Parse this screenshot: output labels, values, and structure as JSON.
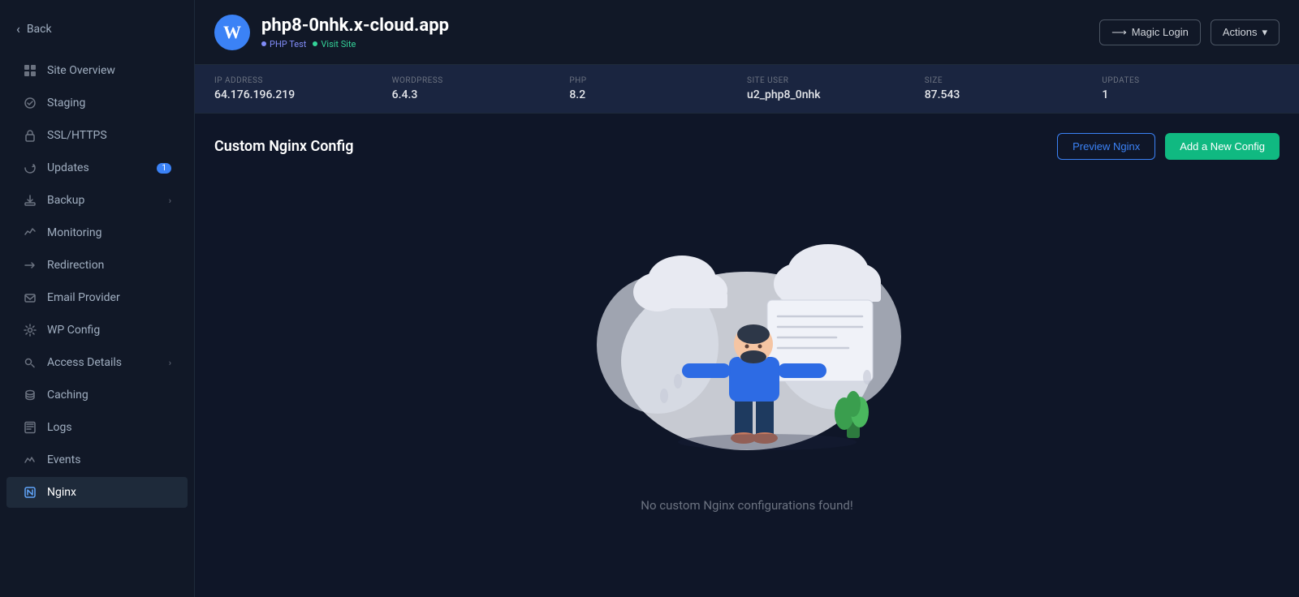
{
  "sidebar": {
    "back_label": "Back",
    "items": [
      {
        "id": "site-overview",
        "label": "Site Overview",
        "icon": "⊞"
      },
      {
        "id": "staging",
        "label": "Staging",
        "icon": "⚡"
      },
      {
        "id": "ssl-https",
        "label": "SSL/HTTPS",
        "icon": "🔒"
      },
      {
        "id": "updates",
        "label": "Updates",
        "icon": "🔄",
        "badge": "1"
      },
      {
        "id": "backup",
        "label": "Backup",
        "icon": "💾",
        "chevron": "›"
      },
      {
        "id": "monitoring",
        "label": "Monitoring",
        "icon": "📊"
      },
      {
        "id": "redirection",
        "label": "Redirection",
        "icon": "↗"
      },
      {
        "id": "email-provider",
        "label": "Email Provider",
        "icon": "✉"
      },
      {
        "id": "wp-config",
        "label": "WP Config",
        "icon": "⚙"
      },
      {
        "id": "access-details",
        "label": "Access Details",
        "icon": "🔑",
        "chevron": "›"
      },
      {
        "id": "caching",
        "label": "Caching",
        "icon": "🗄"
      },
      {
        "id": "logs",
        "label": "Logs",
        "icon": "📋"
      },
      {
        "id": "events",
        "label": "Events",
        "icon": "📈"
      },
      {
        "id": "nginx",
        "label": "Nginx",
        "icon": "⊡",
        "active": true
      }
    ]
  },
  "header": {
    "site_name": "php8-0nhk.x-cloud.app",
    "logo_text": "W",
    "tag_php": "PHP Test",
    "tag_visit": "Visit Site",
    "magic_login_label": "Magic Login",
    "actions_label": "Actions"
  },
  "stats": [
    {
      "label": "IP ADDRESS",
      "value": "64.176.196.219"
    },
    {
      "label": "WORDPRESS",
      "value": "6.4.3"
    },
    {
      "label": "PHP",
      "value": "8.2"
    },
    {
      "label": "SITE USER",
      "value": "u2_php8_0nhk"
    },
    {
      "label": "SIZE",
      "value": "87.543"
    },
    {
      "label": "UPDATES",
      "value": "1"
    }
  ],
  "config": {
    "title": "Custom Nginx Config",
    "preview_btn_label": "Preview Nginx",
    "add_btn_label": "Add a New Config",
    "empty_message": "No custom Nginx configurations found!"
  }
}
